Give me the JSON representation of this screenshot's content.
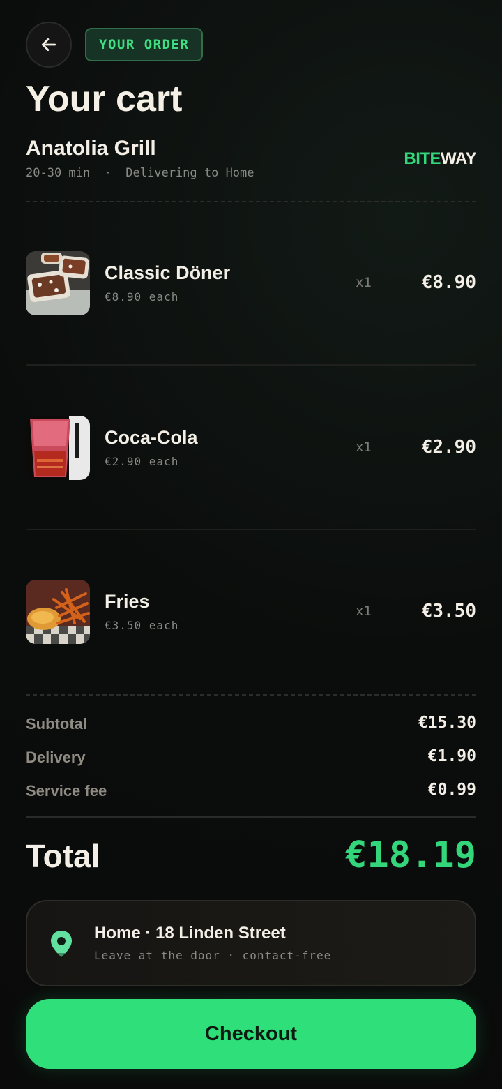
{
  "header": {
    "back_icon": "arrow-left-icon",
    "badge": "YOUR ORDER",
    "title": "Your cart"
  },
  "restaurant": {
    "name": "Anatolia Grill",
    "meta": "20-30 min  ·  Delivering to Home"
  },
  "brand": {
    "part1": "BITE",
    "part2": "WAY",
    "accent": "#33d67a"
  },
  "items": [
    {
      "name": "Classic Döner",
      "each": "€8.90 each",
      "qty": "x1",
      "price": "€8.90"
    },
    {
      "name": "Coca-Cola",
      "each": "€2.90 each",
      "qty": "x1",
      "price": "€2.90"
    },
    {
      "name": "Fries",
      "each": "€3.50 each",
      "qty": "x1",
      "price": "€3.50"
    }
  ],
  "summary": {
    "subtotal_label": "Subtotal",
    "subtotal": "€15.30",
    "delivery_label": "Delivery",
    "delivery": "€1.90",
    "service_label": "Service fee",
    "service": "€0.99",
    "total_label": "Total",
    "total": "€18.19"
  },
  "address": {
    "icon": "location-pin-icon",
    "title": "Home · 18 Linden Street",
    "note": "Leave at the door · contact-free"
  },
  "checkout": {
    "label": "Checkout"
  }
}
